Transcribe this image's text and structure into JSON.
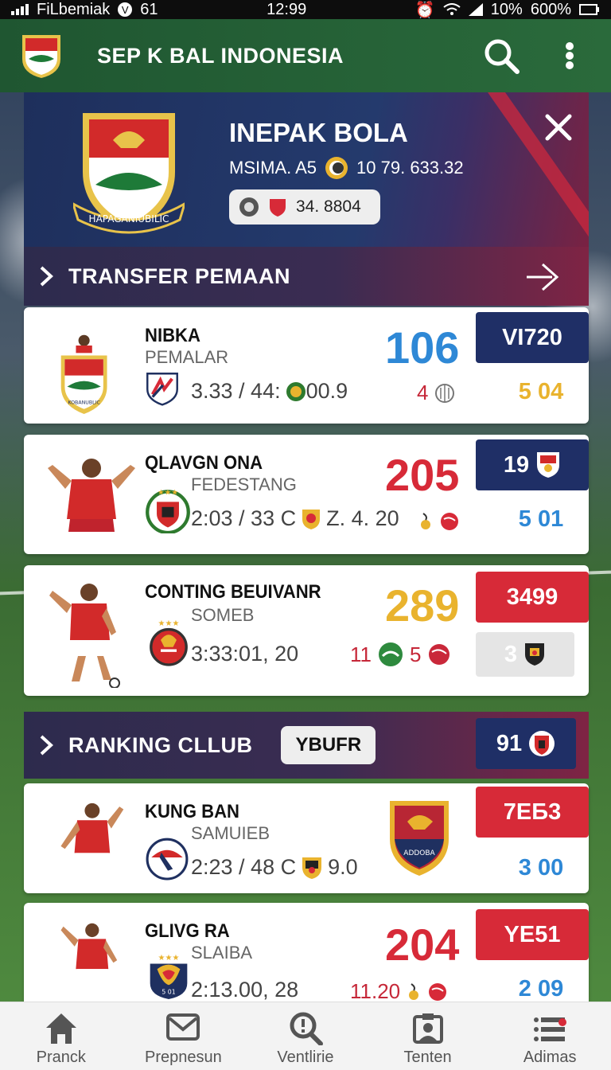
{
  "statusbar": {
    "carrier": "FiLbemiak",
    "extra": "61",
    "time": "12:99",
    "battery_pct": "10%",
    "battery_label": "600%"
  },
  "appbar": {
    "title": "SEP K BAL INDONESIA",
    "search_icon": "search-icon",
    "menu_icon": "more-vertical-icon"
  },
  "club": {
    "name": "INEPAK BOLA",
    "season_label": "MSIMA. A5",
    "season_value": "10 79. 633.32",
    "pill_value": "34. 8804",
    "crest_text": "HAPAGANIUBILIC",
    "close_icon": "close-icon"
  },
  "section_transfer": {
    "label": "TRANSFER PEMAAN",
    "arrow_icon": "arrow-right-icon"
  },
  "players": [
    {
      "name": "NIBKA",
      "position": "PEMALAR",
      "stats": "3.33 / 44:",
      "stats_extra": "00.9",
      "big": "106",
      "small": "4",
      "tag": "VI720",
      "sub": "5 04",
      "crest_text": "KOBANUBLIC"
    },
    {
      "name": "QLAVGN ONA",
      "position": "FEDESTANG",
      "stats": "2:03 / 33 C",
      "stats_extra": "Z. 4. 20",
      "big": "205",
      "small": "",
      "tag": "19",
      "sub": "5 01"
    },
    {
      "name": "CONTING BEUIVANR",
      "position": "SOMEB",
      "stats": "3:33:01, 20",
      "stats_extra": "",
      "big": "289",
      "small": "11",
      "small2": "5",
      "tag": "3499",
      "sub": "3"
    }
  ],
  "section_ranking": {
    "label": "RANKING CLLUB",
    "chip": "YBUFR",
    "tag": "91"
  },
  "clubs": [
    {
      "name": "KUNG BAN",
      "position": "SAMUIEB",
      "stats": "2:23 / 48 C",
      "stats_extra": "9.0",
      "tag": "7EБ3",
      "sub": "3 00",
      "crest_text": "ADDOBA"
    },
    {
      "name": "GLIVG RA",
      "position": "SLAIBA",
      "stats": "2:13.00, 28",
      "small": "11.20",
      "big": "204",
      "tag": "YE51",
      "sub": "2 09",
      "badge_text": "5 01"
    }
  ],
  "nav": [
    {
      "label": "Pranck",
      "icon": "home-icon"
    },
    {
      "label": "Prepnesun",
      "icon": "mail-icon"
    },
    {
      "label": "Ventlirie",
      "icon": "search-icon"
    },
    {
      "label": "Tenten",
      "icon": "profile-card-icon"
    },
    {
      "label": "Adimas",
      "icon": "list-icon"
    }
  ],
  "colors": {
    "appbar": "#1f5631",
    "accent_blue": "#2e88d6",
    "accent_red": "#d72a38",
    "accent_gold": "#e9b32e",
    "tag_navy": "#1f2f66"
  }
}
